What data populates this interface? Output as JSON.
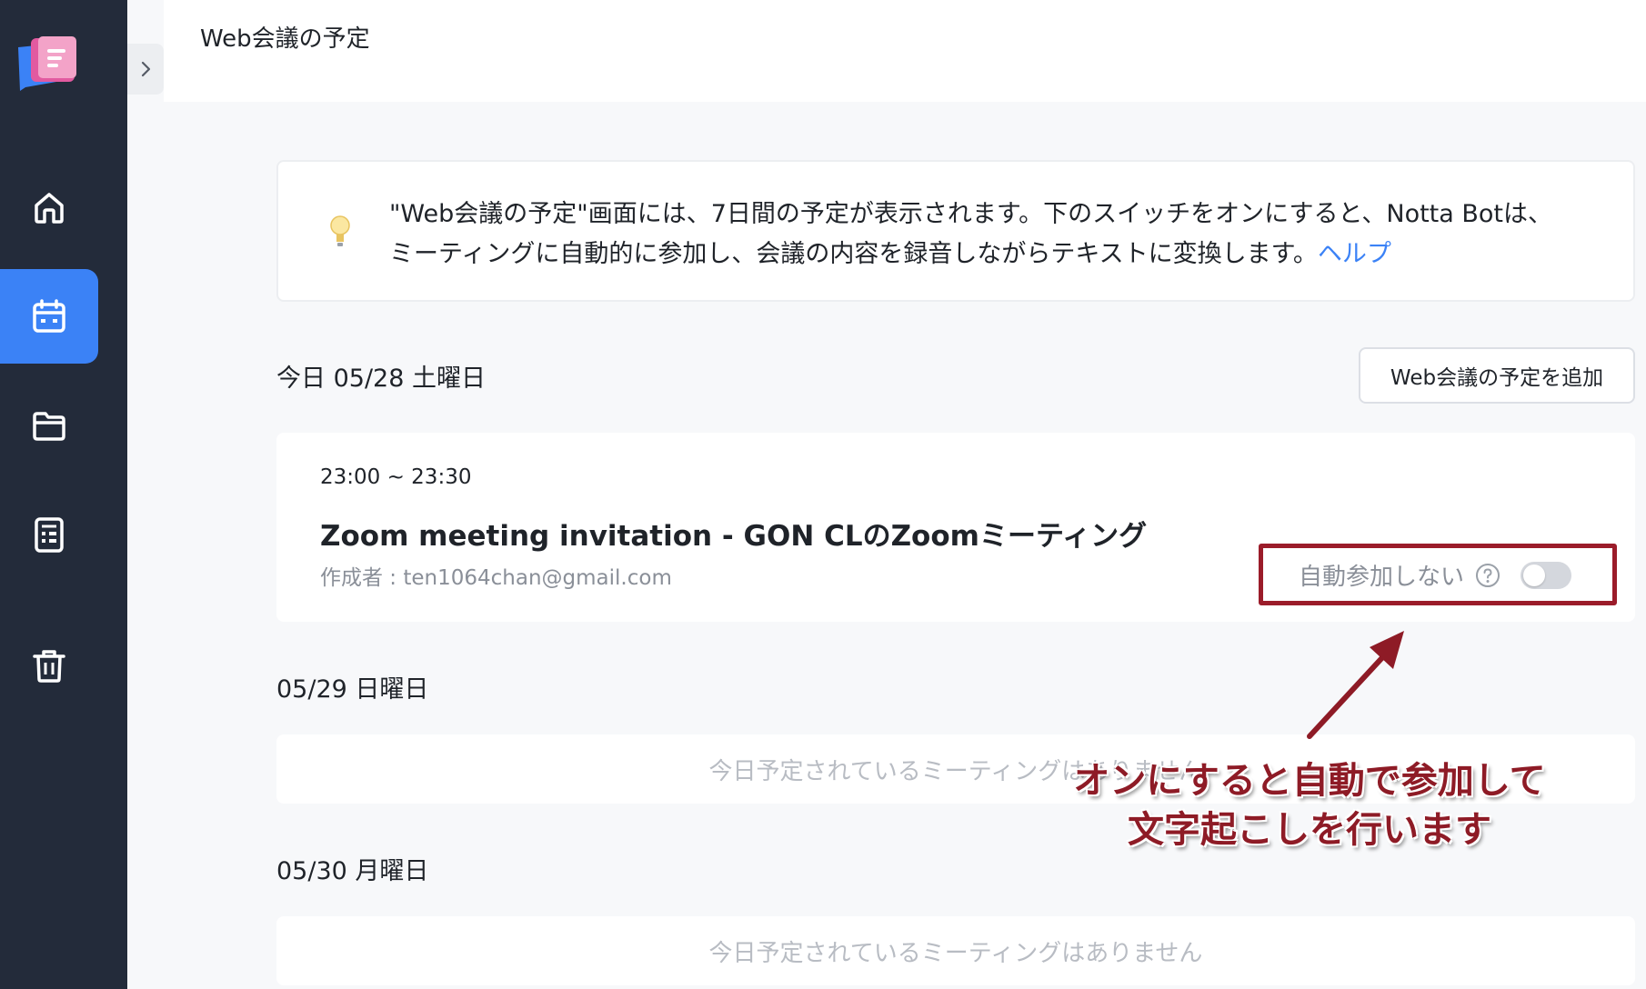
{
  "header": {
    "title": "Web会議の予定"
  },
  "sidebar": {
    "items": [
      {
        "icon": "home-icon",
        "active": false
      },
      {
        "icon": "calendar-icon",
        "active": true
      },
      {
        "icon": "folder-icon",
        "active": false
      },
      {
        "icon": "template-icon",
        "active": false
      },
      {
        "icon": "trash-icon",
        "active": false
      }
    ]
  },
  "info": {
    "text": "\"Web会議の予定\"画面には、7日間の予定が表示されます。下のスイッチをオンにすると、Notta Botは、ミーティングに自動的に参加し、会議の内容を録音しながらテキストに変換します。",
    "link": "ヘルプ"
  },
  "days": [
    {
      "label": "今日 05/28 土曜日",
      "meeting": {
        "time": "23:00 ~ 23:30",
        "title": "Zoom meeting invitation - GON CLのZoomミーティング",
        "creator": "作成者 : ten1064chan@gmail.com",
        "auto_join_label": "自動参加しない",
        "auto_join_on": false
      }
    },
    {
      "label": "05/29 日曜日",
      "empty_text": "今日予定されているミーティングはありません"
    },
    {
      "label": "05/30 月曜日",
      "empty_text": "今日予定されているミーティングはありません"
    }
  ],
  "add_button": "Web会議の予定を追加",
  "annotation": {
    "line1": "オンにすると自動で参加して",
    "line2": "文字起こしを行います"
  },
  "colors": {
    "sidebar": "#232b3a",
    "accent": "#3b82f6",
    "annotation": "#8e1b26"
  }
}
